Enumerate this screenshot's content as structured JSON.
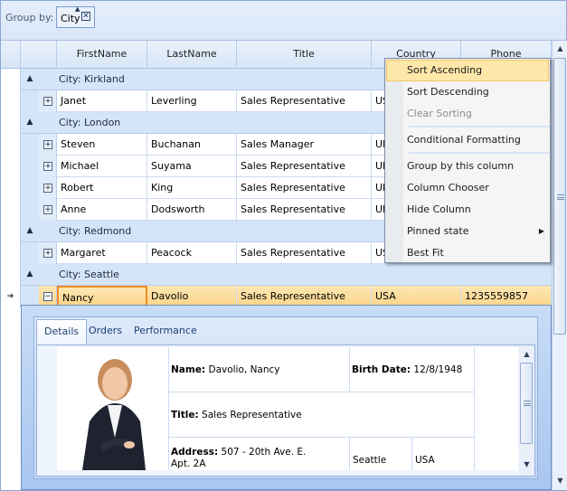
{
  "group_panel": {
    "label": "Group by:",
    "chip": {
      "label": "City",
      "sort_icon": "▲",
      "close_icon": "✕"
    }
  },
  "grid": {
    "columns": [
      "FirstName",
      "LastName",
      "Title",
      "Country",
      "Phone"
    ],
    "groups": [
      {
        "label": "City: Kirkland",
        "rows": [
          {
            "first": "Janet",
            "last": "Leverling",
            "title": "Sales Representative",
            "country": "USA",
            "phone": ""
          }
        ]
      },
      {
        "label": "City: London",
        "rows": [
          {
            "first": "Steven",
            "last": "Buchanan",
            "title": "Sales Manager",
            "country": "UK",
            "phone": ""
          },
          {
            "first": "Michael",
            "last": "Suyama",
            "title": "Sales Representative",
            "country": "UK",
            "phone": ""
          },
          {
            "first": "Robert",
            "last": "King",
            "title": "Sales Representative",
            "country": "UK",
            "phone": ""
          },
          {
            "first": "Anne",
            "last": "Dodsworth",
            "title": "Sales Representative",
            "country": "UK",
            "phone": ""
          }
        ]
      },
      {
        "label": "City: Redmond",
        "rows": [
          {
            "first": "Margaret",
            "last": "Peacock",
            "title": "Sales Representative",
            "country": "USA",
            "phone": ""
          }
        ]
      },
      {
        "label": "City: Seattle",
        "rows": [
          {
            "first": "Nancy",
            "last": "Davolio",
            "title": "Sales Representative",
            "country": "USA",
            "phone": "1235559857"
          }
        ]
      }
    ],
    "selected_indicator": "➔",
    "expand_icon": "+",
    "collapse_row_icon": "−",
    "group_collapse_icon": "▲"
  },
  "details": {
    "tabs": [
      "Details",
      "Orders",
      "Performance"
    ],
    "active_tab": "Details",
    "name_label": "Name:",
    "name_value": "Davolio, Nancy",
    "birth_label": "Birth Date:",
    "birth_value": "12/8/1948",
    "title_label": "Title:",
    "title_value": "Sales Representative",
    "address_label": "Address:",
    "address_line1": "507 - 20th Ave. E.",
    "address_line2": "Apt. 2A",
    "city": "Seattle",
    "country": "USA"
  },
  "context_menu": {
    "items": [
      {
        "label": "Sort Ascending",
        "state": "hover"
      },
      {
        "label": "Sort Descending",
        "state": "normal"
      },
      {
        "label": "Clear Sorting",
        "state": "disabled"
      },
      {
        "label": "Conditional Formatting",
        "state": "normal"
      },
      {
        "label": "Group by this column",
        "state": "normal"
      },
      {
        "label": "Column Chooser",
        "state": "normal"
      },
      {
        "label": "Hide Column",
        "state": "normal"
      },
      {
        "label": "Pinned state",
        "state": "normal",
        "submenu": true
      },
      {
        "label": "Best Fit",
        "state": "normal"
      }
    ],
    "submenu_arrow": "▶"
  },
  "scrollbar": {
    "up": "▲",
    "down": "▼"
  }
}
